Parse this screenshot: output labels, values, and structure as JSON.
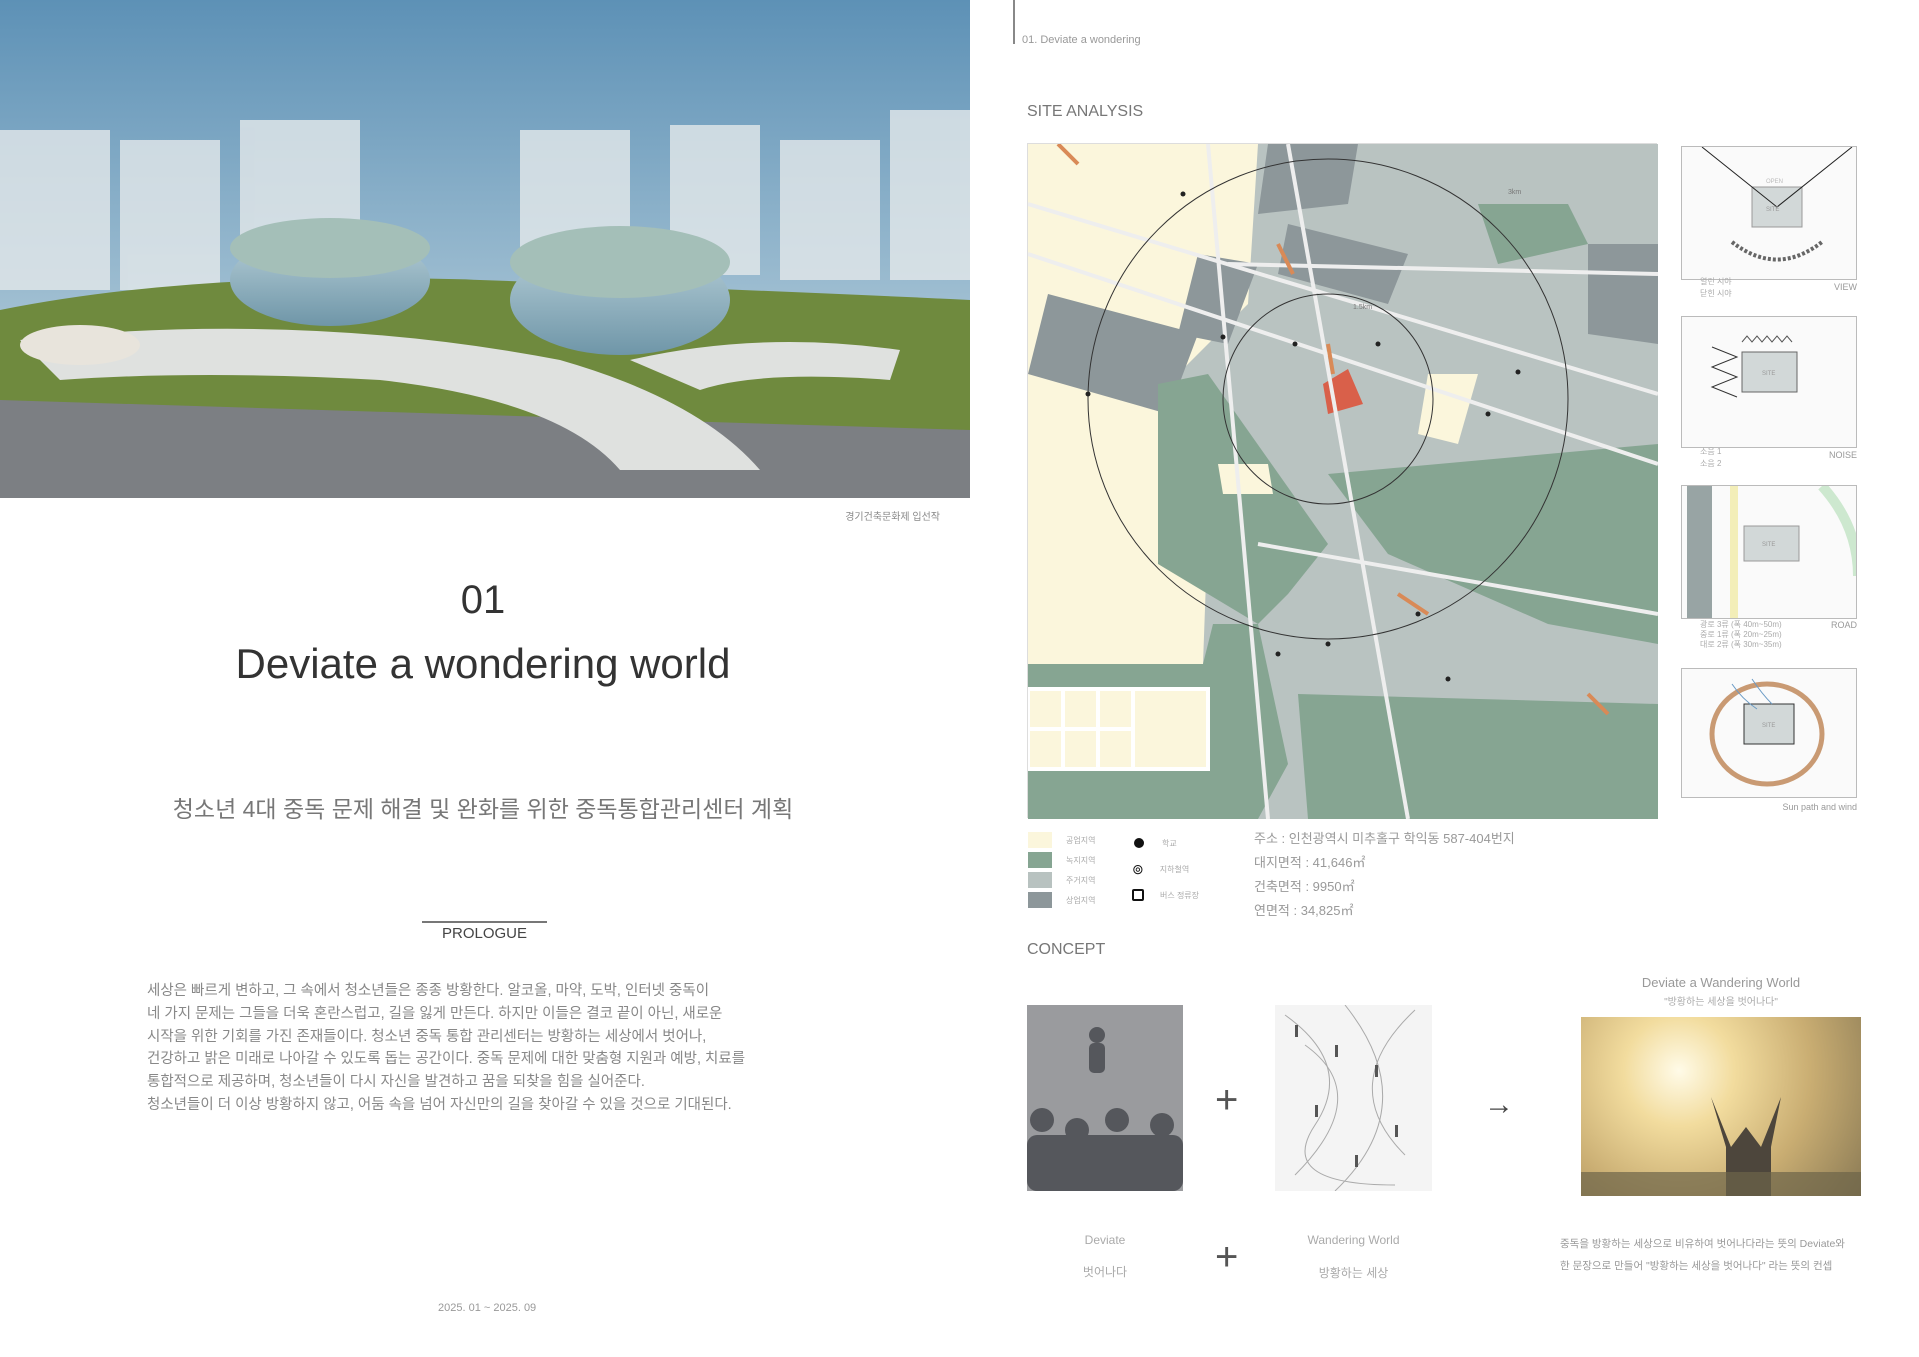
{
  "left_page": {
    "rendering_caption": "경기건축문화제 입선작",
    "number": "01",
    "title": "Deviate a wondering world",
    "subtitle": "청소년 4대 중독 문제 해결 및 완화를 위한 중독통합관리센터 계획",
    "prologue_label": "PROLOGUE",
    "prologue_lines": [
      "세상은 빠르게 변하고, 그 속에서 청소년들은 종종 방황한다. 알코올, 마약, 도박, 인터넷 중독이",
      "네 가지 문제는 그들을 더욱 혼란스럽고, 길을 잃게 만든다. 하지만 이들은 결코 끝이 아닌, 새로운",
      "시작을 위한 기회를 가진 존재들이다. 청소년 중독 통합 관리센터는 방황하는 세상에서 벗어나,",
      "건강하고 밝은 미래로 나아갈 수 있도록 돕는 공간이다. 중독 문제에 대한 맞춤형 지원과 예방, 치료를",
      "통합적으로 제공하며, 청소년들이 다시 자신을 발견하고 꿈을 되찾을 힘을 실어준다.",
      "청소년들이 더 이상 방황하지 않고, 어둠 속을 넘어 자신만의 길을 찾아갈 수 있을 것으로 기대된다."
    ],
    "date": "2025. 01 ~ 2025. 09"
  },
  "right_page": {
    "header": "01. Deviate a wondering",
    "site_analysis_title": "SITE ANALYSIS",
    "map_labels": {
      "r1": "1.5km",
      "r2": "3km"
    },
    "panels": [
      {
        "label": "VIEW",
        "site": "SITE",
        "extra": "OPEN",
        "legend": [
          "열린 시야",
          "닫힌 시야"
        ]
      },
      {
        "label": "NOISE",
        "site": "SITE",
        "legend": [
          "소음 1",
          "소음 2"
        ]
      },
      {
        "label": "ROAD",
        "site": "SITE",
        "legend": [
          "광로 3류 (폭 40m~50m)",
          "중로 1류 (폭 20m~25m)",
          "대로 2류 (폭 30m~35m)"
        ]
      },
      {
        "label": "Sun path and wind",
        "site": "SITE"
      }
    ],
    "zone_legend": [
      {
        "label": "공업지역",
        "color": "#fbf6dc"
      },
      {
        "label": "녹지지역",
        "color": "#86a592"
      },
      {
        "label": "주거지역",
        "color": "#b8c2c0"
      },
      {
        "label": "상업지역",
        "color": "#8d979a"
      }
    ],
    "poi_legend": [
      {
        "label": "학교",
        "icon": "dot-icon"
      },
      {
        "label": "지하철역",
        "icon": "subway-pin-icon"
      },
      {
        "label": "버스 정류장",
        "icon": "bus-icon"
      }
    ],
    "site_info": [
      "주소 : 인천광역시 미추홀구 학익동 587-404번지",
      "대지면적 : 41,646㎡",
      "건축면적 : 9950㎡",
      "연면적 : 34,825㎡"
    ],
    "concept_title": "CONCEPT",
    "concept_result_title": "Deviate a Wandering World",
    "concept_result_quote": "\"방황하는 세상을 벗어나다\"",
    "concept_items": [
      {
        "en": "Deviate",
        "ko": "벗어나다"
      },
      {
        "en": "Wandering World",
        "ko": "방황하는 세상"
      }
    ],
    "concept_desc": [
      "중독을 방황하는 세상으로 비유하여 벗어나다라는 뜻의 Deviate와",
      "한 문장으로 만들어 \"방황하는 세상을 벗어나다\" 라는 뜻의 컨셉"
    ],
    "symbols": {
      "plus": "+",
      "arrow": "→"
    },
    "colors": {
      "site": "#d9604a",
      "road_highlight": "#d98a57"
    }
  }
}
